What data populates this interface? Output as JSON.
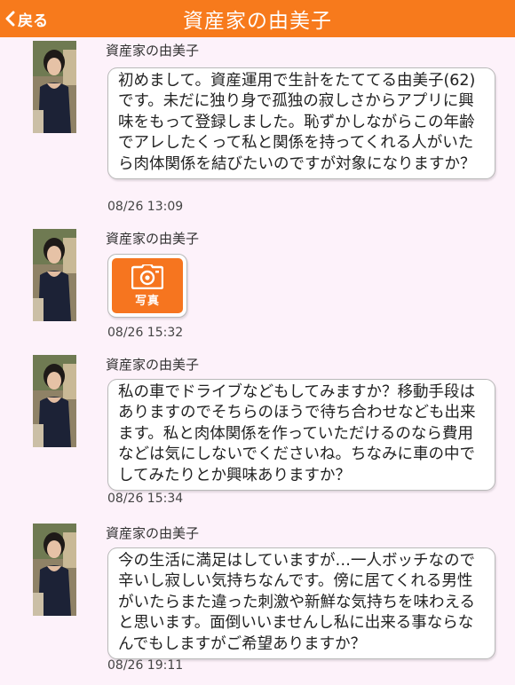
{
  "header": {
    "back_label": "戻る",
    "title": "資産家の由美子"
  },
  "colors": {
    "header_bg": "#f77a1c",
    "page_bg": "#fdf2fa",
    "photo_icon_bg": "#f6751f"
  },
  "messages": [
    {
      "sender": "資産家の由美子",
      "text": "初めまして。資産運用で生計をたててる由美子(62)です。未だに独り身で孤独の寂しさからアプリに興味をもって登録しました。恥ずかしながらこの年齢でアレしたくって私と関係を持ってくれる人がいたら肉体関係を結びたいのですが対象になりますか？",
      "time": "08/26 13:09"
    },
    {
      "sender": "資産家の由美子",
      "photo_label": "写真",
      "photo_icon": "camera-icon",
      "time": "08/26 15:32"
    },
    {
      "sender": "資産家の由美子",
      "text": "私の車でドライブなどもしてみますか？移動手段はありますのでそちらのほうで待ち合わせなども出来ます。私と肉体関係を作っていただけるのなら費用などは気にしないでくださいね。ちなみに車の中でしてみたりとか興味ありますか？",
      "time": "08/26 15:34"
    },
    {
      "sender": "資産家の由美子",
      "text": "今の生活に満足はしていますが…一人ボッチなので辛いし寂しい気持ちなんです。傍に居てくれる男性がいたらまた違った刺激や新鮮な気持ちを味わえると思います。面倒いいませんし私に出来る事ならなんでもしますがご希望ありますか？",
      "time": "08/26 19:11"
    }
  ]
}
